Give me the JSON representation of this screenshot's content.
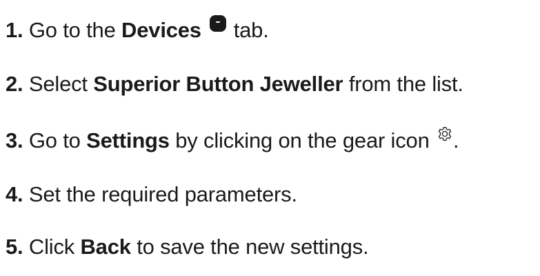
{
  "steps": [
    {
      "num": "1.",
      "pre": "Go to the",
      "bold": "Devices",
      "post": "tab."
    },
    {
      "num": "2.",
      "pre": "Select",
      "bold": "Superior Button Jeweller",
      "post": "from the list."
    },
    {
      "num": "3.",
      "pre": "Go to",
      "bold": "Settings",
      "post": "by clicking on the gear icon",
      "end": "."
    },
    {
      "num": "4.",
      "text": "Set the required parameters."
    },
    {
      "num": "5.",
      "pre": "Click",
      "bold": "Back",
      "post": "to save the new settings."
    }
  ],
  "icons": {
    "devices": "devices-tab-icon",
    "gear": "gear-icon"
  }
}
